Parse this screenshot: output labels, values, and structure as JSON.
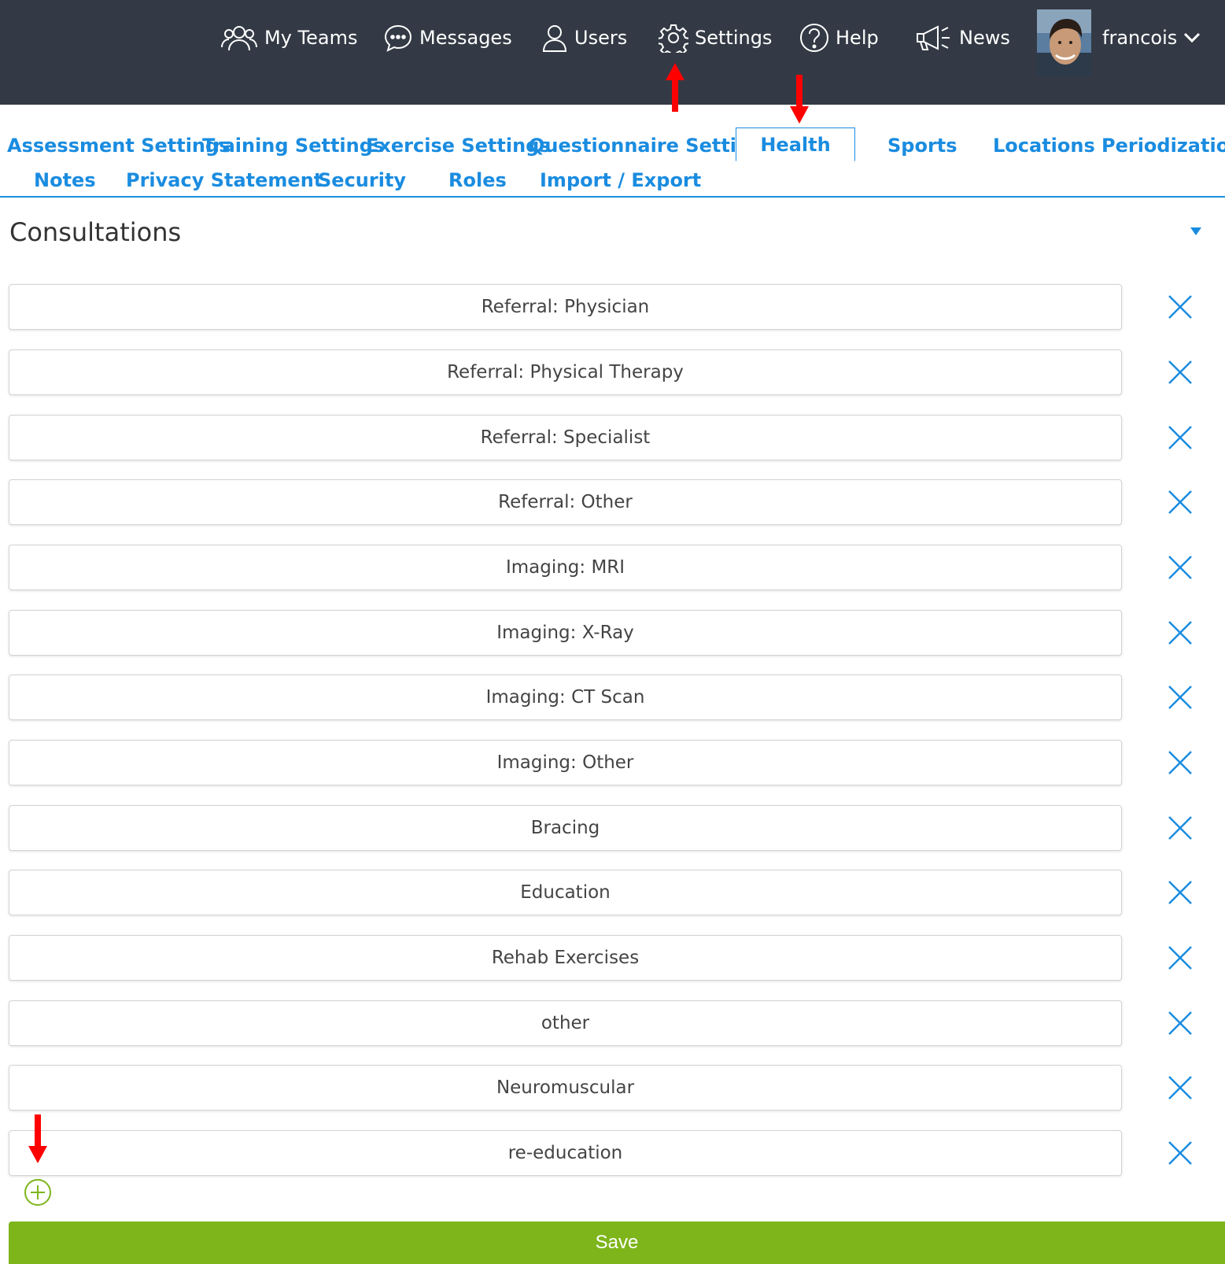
{
  "topnav": {
    "my_teams": "My Teams",
    "messages": "Messages",
    "users": "Users",
    "settings": "Settings",
    "help": "Help",
    "news": "News",
    "username": "francois"
  },
  "tabs": {
    "row1": [
      "Assessment Settings",
      "Training Settings",
      "Exercise Settings",
      "Questionnaire Settings",
      "Health",
      "Sports",
      "Locations",
      "Periodization"
    ],
    "row2": [
      "Notes",
      "Privacy Statement",
      "Security",
      "Roles",
      "Import / Export"
    ],
    "active": "Health"
  },
  "section": {
    "title": "Consultations"
  },
  "consultations": [
    "Referral: Physician",
    "Referral: Physical Therapy",
    "Referral: Specialist",
    "Referral: Other",
    "Imaging: MRI",
    "Imaging: X-Ray",
    "Imaging: CT Scan",
    "Imaging: Other",
    "Bracing",
    "Education",
    "Rehab Exercises",
    "other",
    "Neuromuscular",
    "re-education"
  ],
  "actions": {
    "save": "Save"
  },
  "colors": {
    "topbar": "#333a45",
    "link": "#1a8ce0",
    "save": "#7db51b",
    "add": "#7db51b",
    "annotation_arrow": "#ff0000"
  },
  "icons": [
    "users-icon",
    "chat-bubble-icon",
    "user-icon",
    "gear-icon",
    "question-circle-icon",
    "megaphone-icon",
    "chevron-down-icon",
    "caret-down-icon",
    "close-icon",
    "plus-circle-icon"
  ]
}
